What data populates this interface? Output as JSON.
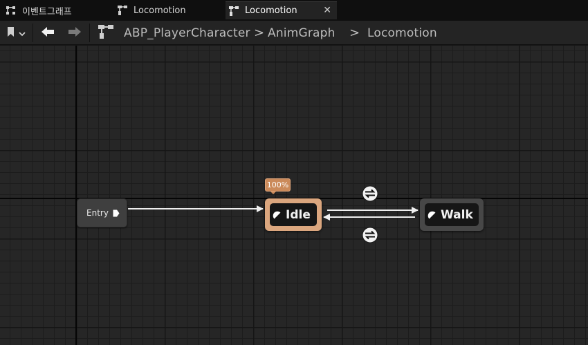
{
  "tabs": [
    {
      "label": "이벤트그래프",
      "icon": "event-graph-icon",
      "active": false
    },
    {
      "label": "Locomotion",
      "icon": "state-machine-icon",
      "active": false
    },
    {
      "label": "Locomotion",
      "icon": "state-machine-icon",
      "active": true,
      "close": "✕"
    }
  ],
  "toolbar": {
    "breadcrumb": [
      {
        "label": "ABP_PlayerCharacter"
      },
      {
        "label": "AnimGraph"
      },
      {
        "label": "Locomotion"
      }
    ],
    "separator": ">"
  },
  "graph": {
    "entry_label": "Entry",
    "states": [
      {
        "name": "Idle",
        "active": true,
        "weight": "100%"
      },
      {
        "name": "Walk",
        "active": false
      }
    ],
    "transitions": [
      {
        "from": "Idle",
        "to": "Walk"
      },
      {
        "from": "Walk",
        "to": "Idle"
      }
    ]
  },
  "colors": {
    "active_state": "#dba67e",
    "weight_badge": "#cb8a5a",
    "inactive_state": "#474747",
    "canvas": "#262626"
  }
}
